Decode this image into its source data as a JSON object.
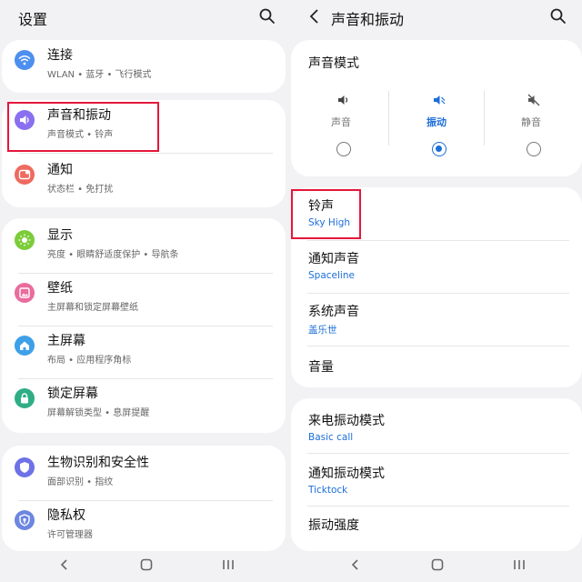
{
  "left": {
    "title": "设置",
    "sections": [
      [
        {
          "title": "连接",
          "sub": "WLAN • 蓝牙 • 飞行模式",
          "icon": "wifi-icon",
          "color": "#4d8fef"
        }
      ],
      [
        {
          "title": "声音和振动",
          "sub": "声音模式 • 铃声",
          "icon": "volume-icon",
          "color": "#8a6ff0"
        },
        {
          "title": "通知",
          "sub": "状态栏 • 免打扰",
          "icon": "notification-icon",
          "color": "#ef6a60"
        }
      ],
      [
        {
          "title": "显示",
          "sub": "亮度 • 眼睛舒适度保护 • 导航条",
          "icon": "brightness-icon",
          "color": "#7ccc3a"
        },
        {
          "title": "壁纸",
          "sub": "主屏幕和锁定屏幕壁纸",
          "icon": "wallpaper-icon",
          "color": "#e96c9d"
        },
        {
          "title": "主屏幕",
          "sub": "布局 • 应用程序角标",
          "icon": "home-icon",
          "color": "#3ea0e8"
        },
        {
          "title": "锁定屏幕",
          "sub": "屏幕解锁类型 • 息屏提醒",
          "icon": "lock-icon",
          "color": "#2fae86"
        }
      ],
      [
        {
          "title": "生物识别和安全性",
          "sub": "面部识别 • 指纹",
          "icon": "shield-icon",
          "color": "#6d72e6"
        },
        {
          "title": "隐私权",
          "sub": "许可管理器",
          "icon": "privacy-icon",
          "color": "#6d86e0"
        }
      ]
    ]
  },
  "right": {
    "title": "声音和振动",
    "sound_mode_title": "声音模式",
    "modes": [
      {
        "label": "声音",
        "icon": "speaker-icon",
        "selected": false
      },
      {
        "label": "振动",
        "icon": "vibrate-icon",
        "selected": true
      },
      {
        "label": "静音",
        "icon": "mute-icon",
        "selected": false
      }
    ],
    "ringtones": [
      {
        "title": "铃声",
        "value": "Sky High"
      },
      {
        "title": "通知声音",
        "value": "Spaceline"
      },
      {
        "title": "系统声音",
        "value": "盖乐世"
      },
      {
        "title": "音量",
        "value": ""
      }
    ],
    "vibrations": [
      {
        "title": "来电振动模式",
        "value": "Basic call"
      },
      {
        "title": "通知振动模式",
        "value": "Ticktock"
      },
      {
        "title": "振动强度",
        "value": ""
      }
    ]
  },
  "colors": {
    "accent": "#1c6ed8",
    "highlight": "#e5163a",
    "background": "#f2f2f4"
  }
}
